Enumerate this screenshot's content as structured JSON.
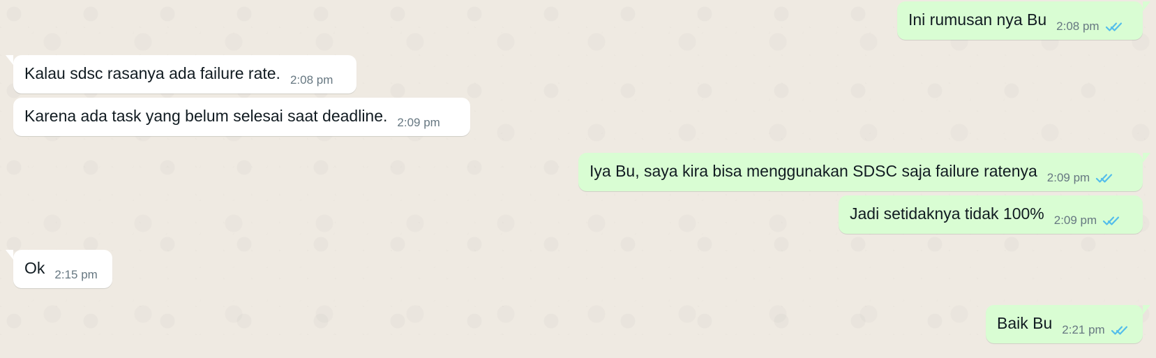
{
  "colors": {
    "chat_background": "#efeae2",
    "incoming_bubble": "#ffffff",
    "outgoing_bubble": "#d9fdd3",
    "message_text": "#111b21",
    "meta_text": "#667781",
    "read_ticks": "#53bdeb"
  },
  "messages": [
    {
      "direction": "outgoing",
      "text": "Ini rumusan nya Bu",
      "time": "2:08 pm",
      "status_icon": "double-check-icon"
    },
    {
      "direction": "incoming",
      "text": "Kalau sdsc rasanya ada failure rate.",
      "time": "2:08 pm"
    },
    {
      "direction": "incoming",
      "text": "Karena ada task yang belum selesai saat deadline.",
      "time": "2:09 pm"
    },
    {
      "direction": "outgoing",
      "text": "Iya Bu, saya kira bisa menggunakan SDSC saja failure ratenya",
      "time": "2:09 pm",
      "status_icon": "double-check-icon"
    },
    {
      "direction": "outgoing",
      "text": "Jadi setidaknya tidak 100%",
      "time": "2:09 pm",
      "status_icon": "double-check-icon"
    },
    {
      "direction": "incoming",
      "text": "Ok",
      "time": "2:15 pm"
    },
    {
      "direction": "outgoing",
      "text": "Baik Bu",
      "time": "2:21 pm",
      "status_icon": "double-check-icon"
    }
  ]
}
